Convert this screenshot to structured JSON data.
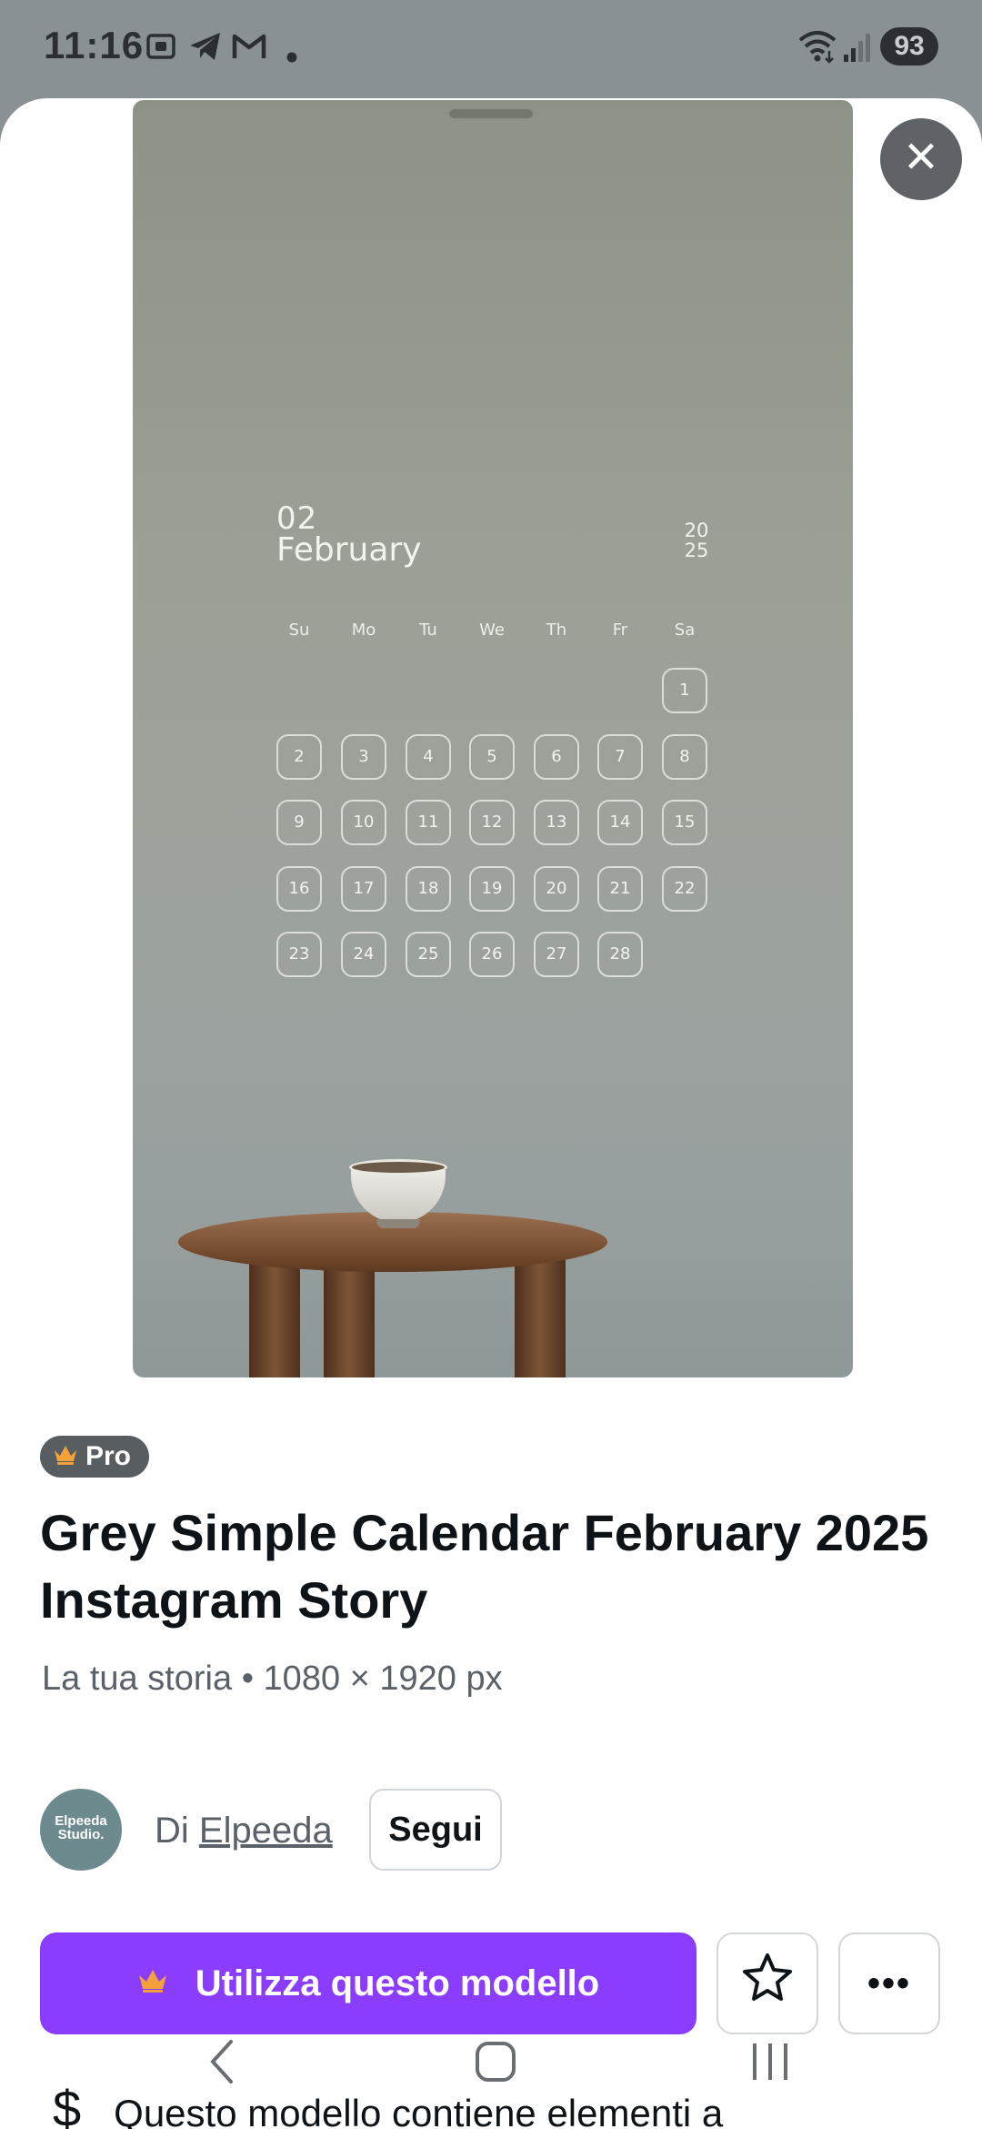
{
  "status_bar": {
    "time": "11:16",
    "left_icons": [
      "screenshot-icon",
      "telegram-icon",
      "gmail-icon",
      "dot-icon"
    ],
    "right_icons": [
      "wifi-icon",
      "signal-icon"
    ],
    "battery": "93"
  },
  "preview": {
    "calendar": {
      "day_number": "02",
      "month": "February",
      "year_top": "20",
      "year_bottom": "25",
      "weekdays": [
        "Su",
        "Mo",
        "Tu",
        "We",
        "Th",
        "Fr",
        "Sa"
      ],
      "days": [
        "1",
        "2",
        "3",
        "4",
        "5",
        "6",
        "7",
        "8",
        "9",
        "10",
        "11",
        "12",
        "13",
        "14",
        "15",
        "16",
        "17",
        "18",
        "19",
        "20",
        "21",
        "22",
        "23",
        "24",
        "25",
        "26",
        "27",
        "28"
      ],
      "first_weekday_index": 6
    }
  },
  "close_icon": "✕",
  "template": {
    "badge": "Pro",
    "title": "Grey Simple Calendar February 2025 Instagram Story",
    "subtitle": "La tua storia • 1080 × 1920 px"
  },
  "author": {
    "avatar_text": "Elpeeda Studio.",
    "by_label": "Di",
    "name": "Elpeeda",
    "follow_label": "Segui"
  },
  "actions": {
    "use_label": "Utilizza questo modello",
    "star_icon": "☆",
    "more_icon": "•••"
  },
  "info": {
    "text": "Questo modello contiene elementi a"
  },
  "colors": {
    "accent": "#8b3dff",
    "crown": "#f5a13b"
  }
}
